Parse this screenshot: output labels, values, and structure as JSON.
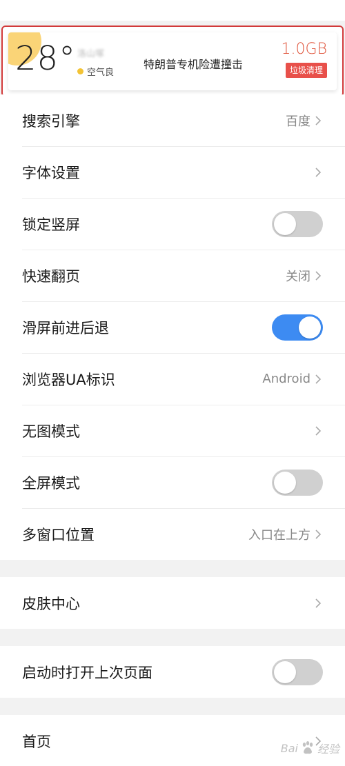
{
  "weather": {
    "temperature": "28°",
    "city": "洛山塚",
    "air_quality": "空气良",
    "headline": "特朗普专机险遭撞击",
    "storage": "1.0GB",
    "clean_button": "垃圾清理"
  },
  "settings": {
    "search_engine": {
      "label": "搜索引擎",
      "value": "百度"
    },
    "font_settings": {
      "label": "字体设置"
    },
    "lock_portrait": {
      "label": "锁定竖屏",
      "enabled": false
    },
    "fast_page_turn": {
      "label": "快速翻页",
      "value": "关闭"
    },
    "swipe_nav": {
      "label": "滑屏前进后退",
      "enabled": true
    },
    "ua": {
      "label": "浏览器UA标识",
      "value": "Android"
    },
    "no_image": {
      "label": "无图模式"
    },
    "fullscreen": {
      "label": "全屏模式",
      "enabled": false
    },
    "multi_window": {
      "label": "多窗口位置",
      "value": "入口在上方"
    },
    "skin_center": {
      "label": "皮肤中心"
    },
    "restore_last": {
      "label": "启动时打开上次页面",
      "enabled": false
    },
    "home": {
      "label": "首页"
    }
  },
  "watermark": {
    "text_left": "Bai",
    "text_right": "经验"
  },
  "colors": {
    "toggle_on": "#3d8bf2",
    "toggle_off": "#d0d0d0",
    "highlight_border": "#d23a3a",
    "clean_button": "#e8504a"
  }
}
